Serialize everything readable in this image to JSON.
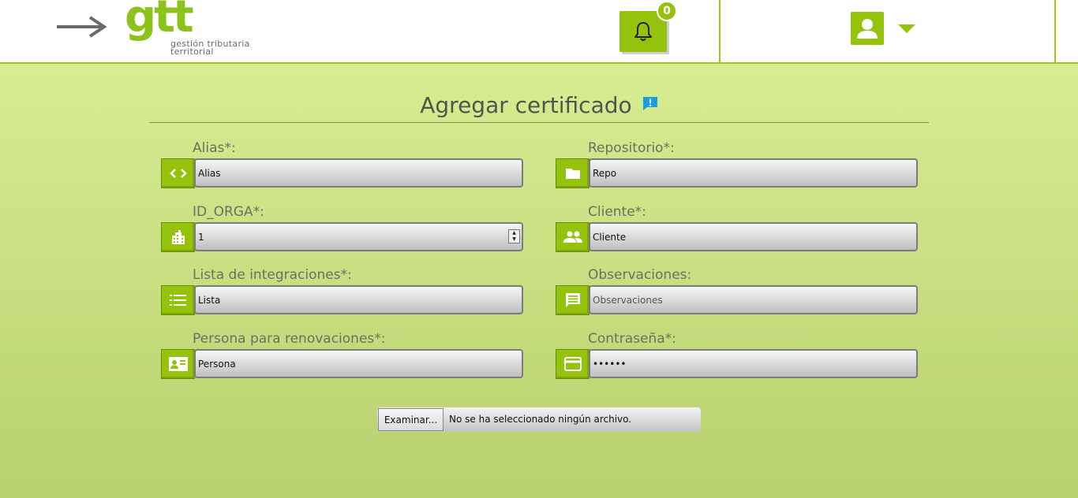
{
  "header": {
    "logo_text": "gtt",
    "logo_subtitle_line1": "gestión tributaria",
    "logo_subtitle_line2": "territorial",
    "notifications_count": "0",
    "brand_color": "#95c20d"
  },
  "form": {
    "title": "Agregar certificado",
    "fields": {
      "alias": {
        "label": "Alias*:",
        "value": "Alias",
        "icon": "code-icon"
      },
      "repositorio": {
        "label": "Repositorio*:",
        "value": "Repo",
        "icon": "folder-icon"
      },
      "id_orga": {
        "label": "ID_ORGA*:",
        "value": "1",
        "icon": "building-icon"
      },
      "cliente": {
        "label": "Cliente*:",
        "value": "Cliente",
        "icon": "people-icon"
      },
      "lista": {
        "label": "Lista de integraciones*:",
        "value": "Lista",
        "icon": "list-icon"
      },
      "observaciones": {
        "label": "Observaciones:",
        "value": "",
        "placeholder": "Observaciones",
        "icon": "comment-icon"
      },
      "persona": {
        "label": "Persona para renovaciones*:",
        "value": "Persona",
        "icon": "contact-card-icon"
      },
      "contrasena": {
        "label": "Contraseña*:",
        "value": "secret",
        "icon": "card-icon"
      }
    },
    "file": {
      "button_label": "Examinar...",
      "status": "No se ha seleccionado ningún archivo."
    }
  }
}
